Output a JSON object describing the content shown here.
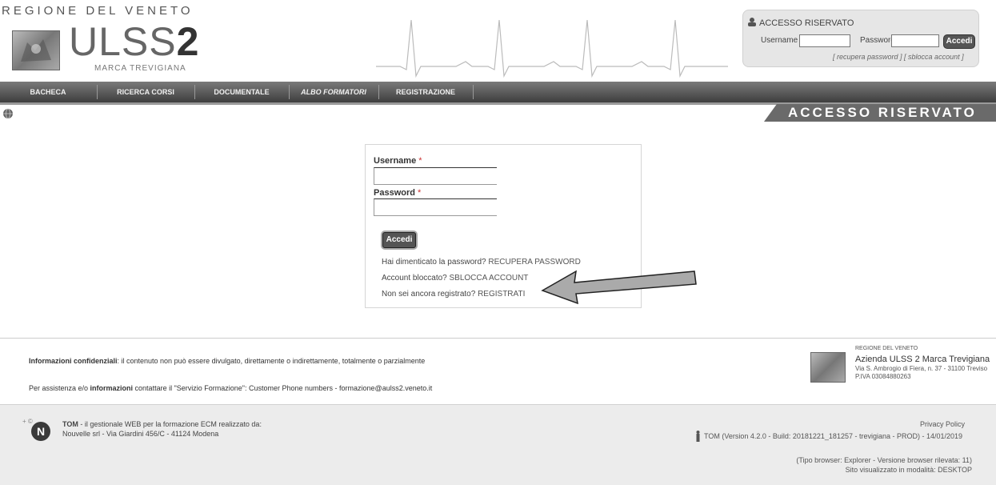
{
  "header": {
    "region": "REGIONE DEL VENETO",
    "brand_light": "ULSS",
    "brand_bold": "2",
    "brand_sub": "MARCA TREVIGIANA"
  },
  "top_login": {
    "title": "ACCESSO RISERVATO",
    "username_label": "Username",
    "password_label": "Password",
    "login_button": "Accedi",
    "links": "[ recupera password ]  [ sblocca account ]"
  },
  "nav": {
    "items": [
      "BACHECA",
      "RICERCA CORSI",
      "DOCUMENTALE",
      "ALBO FORMATORI",
      "REGISTRAZIONE"
    ]
  },
  "section_banner": "ACCESSO RISERVATO",
  "login_card": {
    "username_label": "Username",
    "password_label": "Password",
    "required_mark": "*",
    "submit": "Accedi",
    "forgot_text": "Hai dimenticato la password? ",
    "forgot_link": "RECUPERA PASSWORD",
    "blocked_text": "Account bloccato? ",
    "blocked_link": "SBLOCCA ACCOUNT",
    "register_text": "Non sei ancora registrato? ",
    "register_link": "REGISTRATI"
  },
  "footer": {
    "conf_bold": "Informazioni confidenziali",
    "conf_text": ": il contenuto non può essere divulgato, direttamente o indirettamente, totalmente o parzialmente",
    "assist_pre": "Per assistenza e/o ",
    "assist_bold": "informazioni",
    "assist_text": " contattare il \"Servizio Formazione\": Customer Phone numbers - formazione@aulss2.veneto.it",
    "region": "REGIONE DEL VENETO",
    "azienda": "Azienda ULSS 2 Marca Trevigiana",
    "address": "Via S. Ambrogio di Fiera, n. 37 - 31100 Treviso",
    "piva": "P.IVA 03084880263"
  },
  "bottom": {
    "tom_bold": "TOM",
    "tom_desc": " - il gestionale WEB per la formazione ECM realizzato da:",
    "company": "Nouvelle srl - Via Giardini 456/C - 41124 Modena",
    "privacy": "Privacy Policy",
    "version": "TOM (Version 4.2.0 - Build: 20181221_181257 - trevigiana - PROD) - 14/01/2019",
    "browser": "(Tipo browser: Explorer - Versione browser rilevata: 11)",
    "display_mode": "Sito visualizzato in modalità: DESKTOP"
  }
}
